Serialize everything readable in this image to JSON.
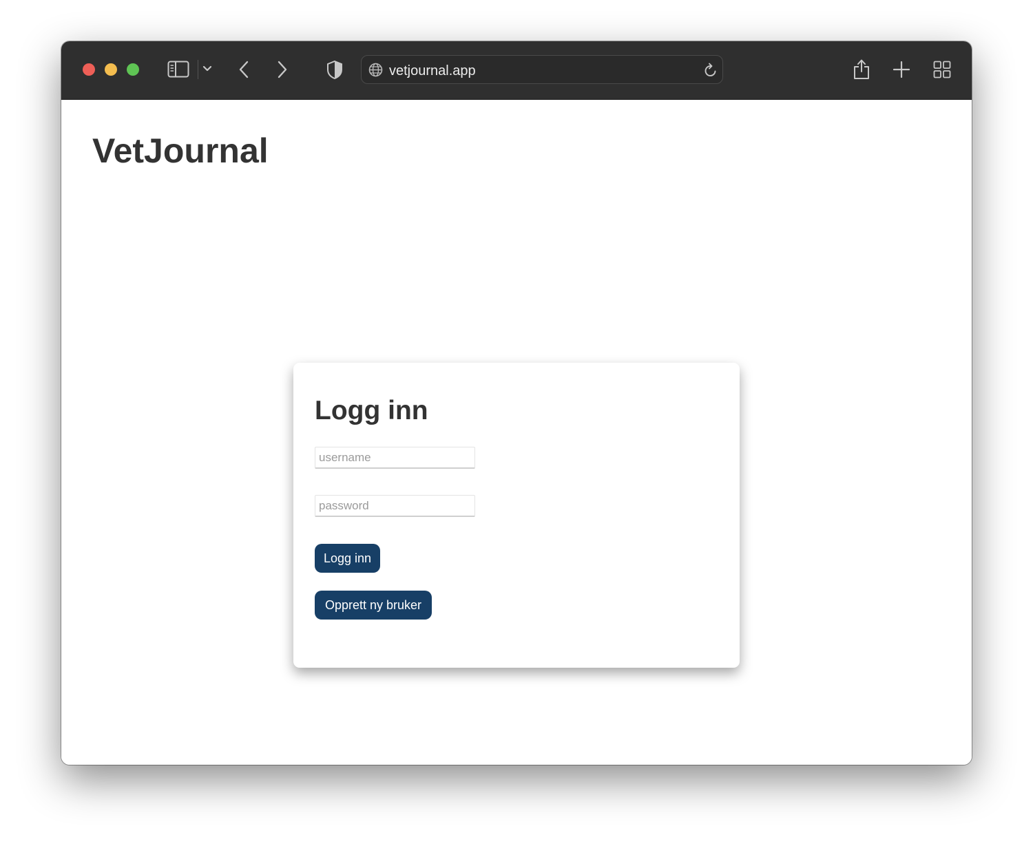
{
  "browser": {
    "url": "vetjournal.app",
    "traffic_lights": {
      "close": "#ee5f57",
      "minimize": "#f4bd4f",
      "zoom": "#5fc454"
    },
    "icons": [
      "sidebar-icon",
      "chevron-down-icon",
      "back-icon",
      "forward-icon",
      "shield-icon",
      "globe-icon",
      "reload-icon",
      "share-icon",
      "new-tab-icon",
      "tab-overview-icon"
    ]
  },
  "page": {
    "site_title": "VetJournal"
  },
  "login": {
    "title": "Logg inn",
    "username_placeholder": "username",
    "username_value": "",
    "password_placeholder": "password",
    "password_value": "",
    "login_button": "Logg inn",
    "register_button": "Opprett ny bruker"
  },
  "colors": {
    "button_bg": "#173f66",
    "title_text": "#333333",
    "toolbar_bg": "#2f2f2f"
  }
}
